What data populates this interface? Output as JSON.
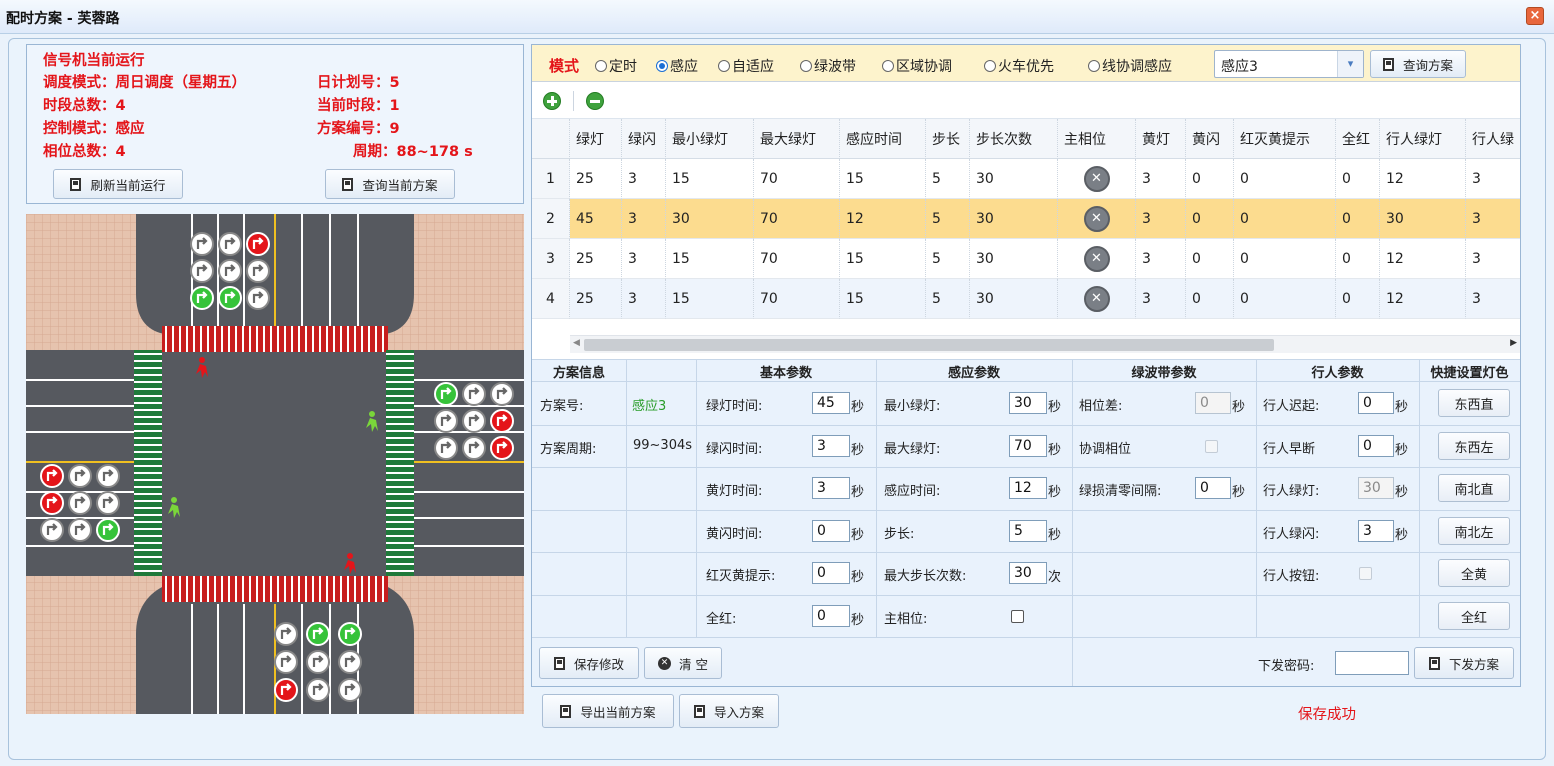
{
  "window": {
    "title": "配时方案 - 芙蓉路",
    "close_icon": "close-icon"
  },
  "status": {
    "heading": "信号机当前运行",
    "schedule_mode": "调度模式：周日调度（星期五）",
    "day_plan": "日计划号：5",
    "period_total": "时段总数：4",
    "current_period": "当前时段：1",
    "control_mode": "控制模式：感应",
    "plan_no": "方案编号：9",
    "phase_total": "相位总数：4",
    "cycle": "周期：88~178 s",
    "refresh_label": "刷新当前运行",
    "query_current_label": "查询当前方案"
  },
  "modebar": {
    "label": "模式",
    "options": [
      {
        "label": "定时",
        "selected": false
      },
      {
        "label": "感应",
        "selected": true
      },
      {
        "label": "自适应",
        "selected": false
      },
      {
        "label": "绿波带",
        "selected": false
      },
      {
        "label": "区域协调",
        "selected": false
      },
      {
        "label": "火车优先",
        "selected": false
      },
      {
        "label": "线协调感应",
        "selected": false
      }
    ],
    "select_value": "感应3",
    "query_label": "查询方案"
  },
  "grid": {
    "columns": [
      "",
      "绿灯",
      "绿闪",
      "最小绿灯",
      "最大绿灯",
      "感应时间",
      "步长",
      "步长次数",
      "主相位",
      "黄灯",
      "黄闪",
      "红灭黄提示",
      "全红",
      "行人绿灯",
      "行人绿"
    ],
    "rows": [
      {
        "n": "1",
        "cells": [
          "25",
          "3",
          "15",
          "70",
          "15",
          "5",
          "30",
          "",
          "3",
          "0",
          "0",
          "0",
          "12",
          "3"
        ]
      },
      {
        "n": "2",
        "cells": [
          "45",
          "3",
          "30",
          "70",
          "12",
          "5",
          "30",
          "",
          "3",
          "0",
          "0",
          "0",
          "30",
          "3"
        ]
      },
      {
        "n": "3",
        "cells": [
          "25",
          "3",
          "15",
          "70",
          "15",
          "5",
          "30",
          "",
          "3",
          "0",
          "0",
          "0",
          "12",
          "3"
        ]
      },
      {
        "n": "4",
        "cells": [
          "25",
          "3",
          "15",
          "70",
          "15",
          "5",
          "30",
          "",
          "3",
          "0",
          "0",
          "0",
          "12",
          "3"
        ]
      }
    ],
    "selected_row": 2
  },
  "params": {
    "headers": {
      "info": "方案信息",
      "basic": "基本参数",
      "induct": "感应参数",
      "greenwave": "绿波带参数",
      "ped": "行人参数",
      "quick": "快捷设置灯色"
    },
    "info": {
      "plan_no_label": "方案号:",
      "plan_no_value": "感应3",
      "cycle_label": "方案周期:",
      "cycle_value": "99~304s"
    },
    "basic": {
      "green_label": "绿灯时间:",
      "green": "45",
      "greenflash_label": "绿闪时间:",
      "greenflash": "3",
      "yellow_label": "黄灯时间:",
      "yellow": "3",
      "yellowflash_label": "黄闪时间:",
      "yellowflash": "0",
      "redoff_label": "红灭黄提示:",
      "redoff": "0",
      "allred_label": "全红:",
      "allred": "0"
    },
    "induct": {
      "mingreen_label": "最小绿灯:",
      "mingreen": "30",
      "maxgreen_label": "最大绿灯:",
      "maxgreen": "70",
      "inducttime_label": "感应时间:",
      "inducttime": "12",
      "step_label": "步长:",
      "step": "5",
      "maxsteps_label": "最大步长次数:",
      "maxsteps": "30",
      "mainphase_label": "主相位:"
    },
    "greenwave": {
      "offset_label": "相位差:",
      "offset": "0",
      "coord_label": "协调相位",
      "clear_label": "绿损清零间隔:",
      "clear": "0"
    },
    "ped": {
      "delay_label": "行人迟起:",
      "delay": "0",
      "early_label": "行人早断",
      "early": "0",
      "green_label": "行人绿灯:",
      "green": "30",
      "flash_label": "行人绿闪:",
      "flash": "3",
      "button_label": "行人按钮:"
    },
    "quick": [
      "东西直",
      "东西左",
      "南北直",
      "南北左",
      "全黄",
      "全红"
    ],
    "units": {
      "sec": "秒",
      "times": "次"
    },
    "save_label": "保存修改",
    "clear_label": "清 空",
    "password_label": "下发密码:",
    "send_label": "下发方案"
  },
  "footer": {
    "export_label": "导出当前方案",
    "import_label": "导入方案",
    "save_status": "保存成功"
  },
  "map": {
    "north_arrows": [
      [
        "uturn",
        "down",
        "right"
      ],
      [
        "uturn",
        "down",
        "right"
      ],
      [
        "uturn",
        "down",
        "right"
      ]
    ],
    "north_colors": [
      [
        "white",
        "white",
        "red"
      ],
      [
        "white",
        "white",
        "white"
      ],
      [
        "green",
        "green",
        "white"
      ]
    ],
    "east_colors": [
      [
        "green",
        "white",
        "white"
      ],
      [
        "white",
        "white",
        "red"
      ],
      [
        "white",
        "white",
        "red"
      ]
    ],
    "west_colors": [
      [
        "red",
        "white",
        "white"
      ],
      [
        "red",
        "white",
        "white"
      ],
      [
        "white",
        "white",
        "green"
      ]
    ],
    "south_colors": [
      [
        "white",
        "green",
        "green"
      ],
      [
        "white",
        "white",
        "white"
      ],
      [
        "red",
        "white",
        "white"
      ]
    ],
    "colors": {
      "red": "#e4151a",
      "green": "#36c33a",
      "white": "#ffffff",
      "road": "#56595f",
      "sidewalk": "#e4bfaa"
    }
  }
}
